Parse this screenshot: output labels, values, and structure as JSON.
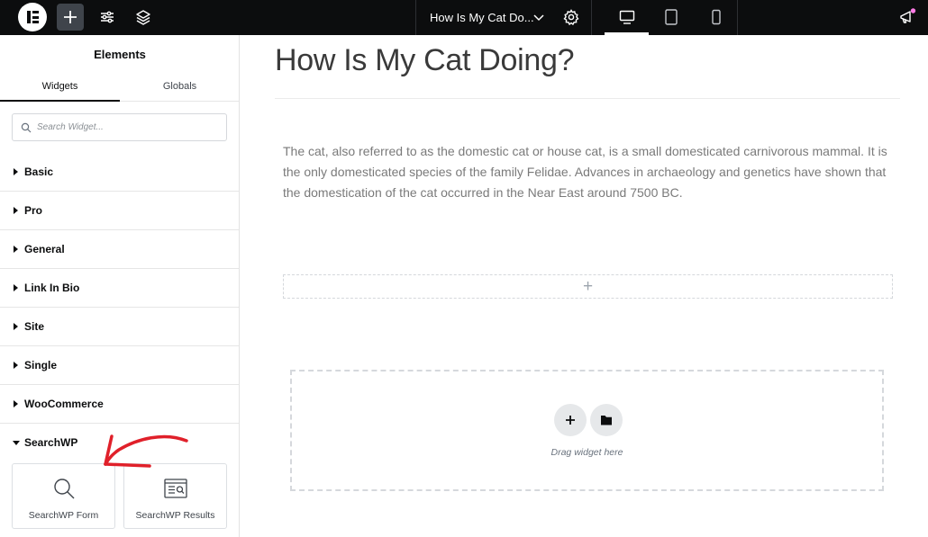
{
  "topbar": {
    "page_title": "How Is My Cat Do...",
    "icons": [
      "elementor-logo-icon",
      "add-element-icon",
      "site-settings-icon",
      "structure-layers-icon",
      "chevron-down-icon",
      "page-settings-icon",
      "desktop-icon",
      "tablet-icon",
      "mobile-icon",
      "whats-new-icon"
    ],
    "accent_color": "#ff7be5"
  },
  "panel": {
    "title": "Elements",
    "tabs": [
      {
        "label": "Widgets",
        "active": true
      },
      {
        "label": "Globals",
        "active": false
      }
    ],
    "search": {
      "placeholder": "Search Widget..."
    },
    "categories": [
      {
        "label": "Basic",
        "expanded": false
      },
      {
        "label": "Pro",
        "expanded": false
      },
      {
        "label": "General",
        "expanded": false
      },
      {
        "label": "Link In Bio",
        "expanded": false
      },
      {
        "label": "Site",
        "expanded": false
      },
      {
        "label": "Single",
        "expanded": false
      },
      {
        "label": "WooCommerce",
        "expanded": false
      },
      {
        "label": "SearchWP",
        "expanded": true
      }
    ],
    "widgets": [
      {
        "label": "SearchWP Form",
        "icon": "search-icon"
      },
      {
        "label": "SearchWP Results",
        "icon": "search-results-icon"
      }
    ]
  },
  "canvas": {
    "heading": "How Is My Cat Doing?",
    "paragraph": "The cat, also referred to as the domestic cat or house cat, is a small domesticated carnivorous mammal. It is the only domesticated species of the family Felidae. Advances in archaeology and genetics have shown that the domestication of the cat occurred in the Near East around 7500 BC.",
    "drop_zone_text": "Drag widget here"
  },
  "annotation": {
    "arrow_color": "#e0202a"
  }
}
